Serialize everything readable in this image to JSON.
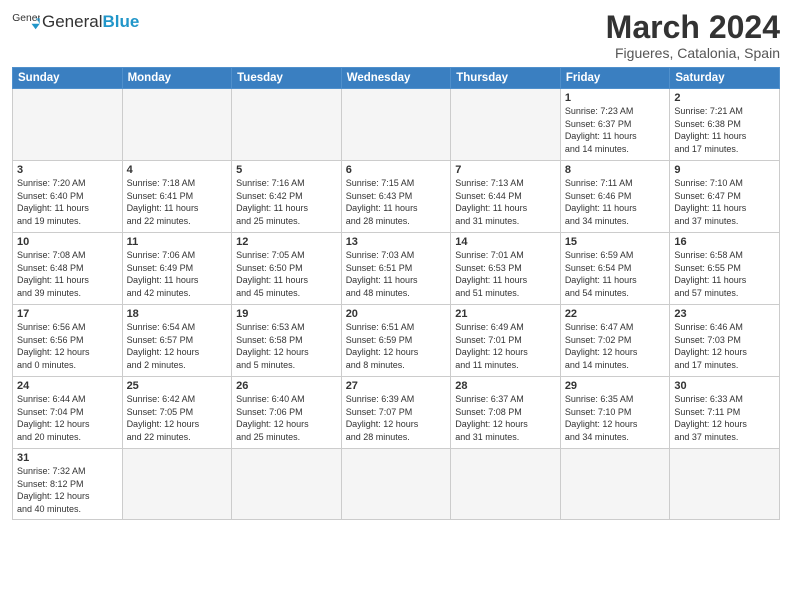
{
  "logo": {
    "text_general": "General",
    "text_blue": "Blue"
  },
  "title": "March 2024",
  "subtitle": "Figueres, Catalonia, Spain",
  "days_of_week": [
    "Sunday",
    "Monday",
    "Tuesday",
    "Wednesday",
    "Thursday",
    "Friday",
    "Saturday"
  ],
  "weeks": [
    [
      {
        "day": "",
        "info": ""
      },
      {
        "day": "",
        "info": ""
      },
      {
        "day": "",
        "info": ""
      },
      {
        "day": "",
        "info": ""
      },
      {
        "day": "",
        "info": ""
      },
      {
        "day": "1",
        "info": "Sunrise: 7:23 AM\nSunset: 6:37 PM\nDaylight: 11 hours\nand 14 minutes."
      },
      {
        "day": "2",
        "info": "Sunrise: 7:21 AM\nSunset: 6:38 PM\nDaylight: 11 hours\nand 17 minutes."
      }
    ],
    [
      {
        "day": "3",
        "info": "Sunrise: 7:20 AM\nSunset: 6:40 PM\nDaylight: 11 hours\nand 19 minutes."
      },
      {
        "day": "4",
        "info": "Sunrise: 7:18 AM\nSunset: 6:41 PM\nDaylight: 11 hours\nand 22 minutes."
      },
      {
        "day": "5",
        "info": "Sunrise: 7:16 AM\nSunset: 6:42 PM\nDaylight: 11 hours\nand 25 minutes."
      },
      {
        "day": "6",
        "info": "Sunrise: 7:15 AM\nSunset: 6:43 PM\nDaylight: 11 hours\nand 28 minutes."
      },
      {
        "day": "7",
        "info": "Sunrise: 7:13 AM\nSunset: 6:44 PM\nDaylight: 11 hours\nand 31 minutes."
      },
      {
        "day": "8",
        "info": "Sunrise: 7:11 AM\nSunset: 6:46 PM\nDaylight: 11 hours\nand 34 minutes."
      },
      {
        "day": "9",
        "info": "Sunrise: 7:10 AM\nSunset: 6:47 PM\nDaylight: 11 hours\nand 37 minutes."
      }
    ],
    [
      {
        "day": "10",
        "info": "Sunrise: 7:08 AM\nSunset: 6:48 PM\nDaylight: 11 hours\nand 39 minutes."
      },
      {
        "day": "11",
        "info": "Sunrise: 7:06 AM\nSunset: 6:49 PM\nDaylight: 11 hours\nand 42 minutes."
      },
      {
        "day": "12",
        "info": "Sunrise: 7:05 AM\nSunset: 6:50 PM\nDaylight: 11 hours\nand 45 minutes."
      },
      {
        "day": "13",
        "info": "Sunrise: 7:03 AM\nSunset: 6:51 PM\nDaylight: 11 hours\nand 48 minutes."
      },
      {
        "day": "14",
        "info": "Sunrise: 7:01 AM\nSunset: 6:53 PM\nDaylight: 11 hours\nand 51 minutes."
      },
      {
        "day": "15",
        "info": "Sunrise: 6:59 AM\nSunset: 6:54 PM\nDaylight: 11 hours\nand 54 minutes."
      },
      {
        "day": "16",
        "info": "Sunrise: 6:58 AM\nSunset: 6:55 PM\nDaylight: 11 hours\nand 57 minutes."
      }
    ],
    [
      {
        "day": "17",
        "info": "Sunrise: 6:56 AM\nSunset: 6:56 PM\nDaylight: 12 hours\nand 0 minutes."
      },
      {
        "day": "18",
        "info": "Sunrise: 6:54 AM\nSunset: 6:57 PM\nDaylight: 12 hours\nand 2 minutes."
      },
      {
        "day": "19",
        "info": "Sunrise: 6:53 AM\nSunset: 6:58 PM\nDaylight: 12 hours\nand 5 minutes."
      },
      {
        "day": "20",
        "info": "Sunrise: 6:51 AM\nSunset: 6:59 PM\nDaylight: 12 hours\nand 8 minutes."
      },
      {
        "day": "21",
        "info": "Sunrise: 6:49 AM\nSunset: 7:01 PM\nDaylight: 12 hours\nand 11 minutes."
      },
      {
        "day": "22",
        "info": "Sunrise: 6:47 AM\nSunset: 7:02 PM\nDaylight: 12 hours\nand 14 minutes."
      },
      {
        "day": "23",
        "info": "Sunrise: 6:46 AM\nSunset: 7:03 PM\nDaylight: 12 hours\nand 17 minutes."
      }
    ],
    [
      {
        "day": "24",
        "info": "Sunrise: 6:44 AM\nSunset: 7:04 PM\nDaylight: 12 hours\nand 20 minutes."
      },
      {
        "day": "25",
        "info": "Sunrise: 6:42 AM\nSunset: 7:05 PM\nDaylight: 12 hours\nand 22 minutes."
      },
      {
        "day": "26",
        "info": "Sunrise: 6:40 AM\nSunset: 7:06 PM\nDaylight: 12 hours\nand 25 minutes."
      },
      {
        "day": "27",
        "info": "Sunrise: 6:39 AM\nSunset: 7:07 PM\nDaylight: 12 hours\nand 28 minutes."
      },
      {
        "day": "28",
        "info": "Sunrise: 6:37 AM\nSunset: 7:08 PM\nDaylight: 12 hours\nand 31 minutes."
      },
      {
        "day": "29",
        "info": "Sunrise: 6:35 AM\nSunset: 7:10 PM\nDaylight: 12 hours\nand 34 minutes."
      },
      {
        "day": "30",
        "info": "Sunrise: 6:33 AM\nSunset: 7:11 PM\nDaylight: 12 hours\nand 37 minutes."
      }
    ],
    [
      {
        "day": "31",
        "info": "Sunrise: 7:32 AM\nSunset: 8:12 PM\nDaylight: 12 hours\nand 40 minutes."
      },
      {
        "day": "",
        "info": ""
      },
      {
        "day": "",
        "info": ""
      },
      {
        "day": "",
        "info": ""
      },
      {
        "day": "",
        "info": ""
      },
      {
        "day": "",
        "info": ""
      },
      {
        "day": "",
        "info": ""
      }
    ]
  ]
}
